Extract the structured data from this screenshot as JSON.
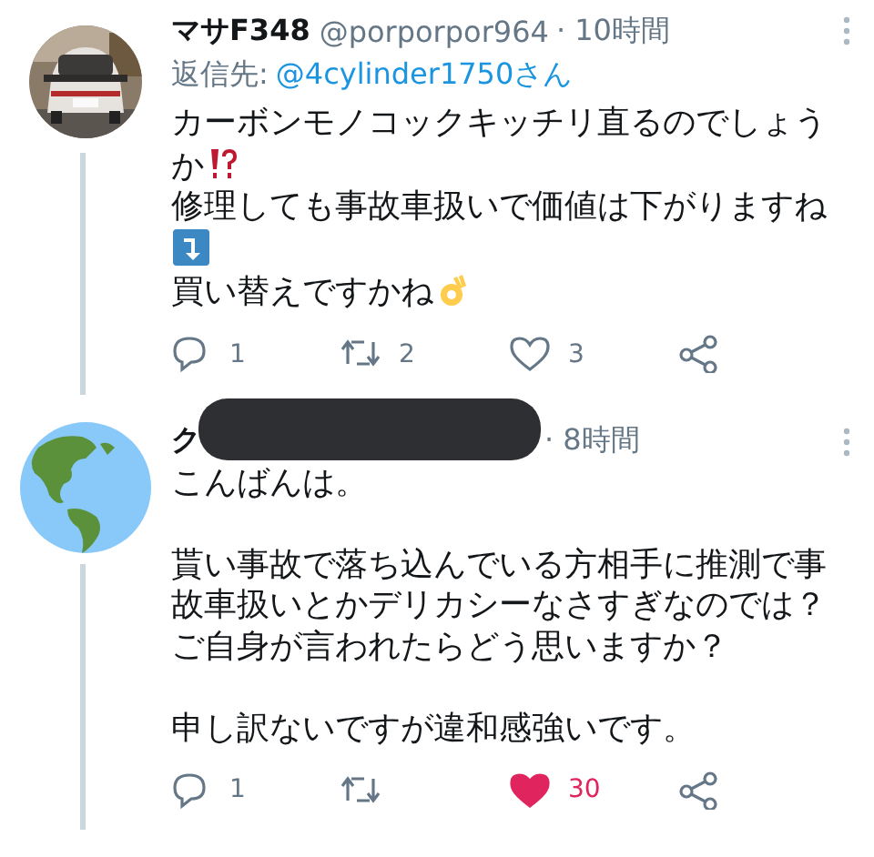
{
  "tweets": [
    {
      "avatar": {
        "kind": "picture"
      },
      "name": "マサF348",
      "handle": "@porporpor964",
      "time": "· 10時間",
      "redacted": false,
      "reply_to_label": "返信先:",
      "reply_to": "@4cylinder1750さん",
      "body": [
        {
          "kind": "text",
          "parts": [
            {
              "kind": "text",
              "text": "カーボンモノコックキッチリ直るのでしょう"
            }
          ]
        },
        {
          "kind": "text",
          "parts": [
            {
              "kind": "text",
              "text": "か"
            },
            {
              "kind": "interrobang"
            }
          ]
        },
        {
          "kind": "text",
          "parts": [
            {
              "kind": "text",
              "text": "修理しても事故車扱いで価値は下がりますね"
            }
          ]
        },
        {
          "kind": "text",
          "parts": [
            {
              "kind": "arrow"
            }
          ]
        },
        {
          "kind": "text",
          "parts": [
            {
              "kind": "text",
              "text": "買い替えですかね"
            },
            {
              "kind": "okhand"
            }
          ]
        }
      ],
      "replies": "1",
      "retweets": "2",
      "likes": "3",
      "liked": false,
      "thread_below": true
    },
    {
      "avatar": {
        "kind": "globe"
      },
      "name": "ク",
      "time": "· 8時間",
      "redacted": true,
      "body": [
        {
          "kind": "text",
          "parts": [
            {
              "kind": "text",
              "text": "こんばんは。"
            }
          ]
        },
        {
          "kind": "blank"
        },
        {
          "kind": "text",
          "parts": [
            {
              "kind": "text",
              "text": "貰い事故で落ち込んでいる方相手に推測で事故車扱いとかデリカシーなさすぎなのでは？"
            }
          ]
        },
        {
          "kind": "text",
          "parts": [
            {
              "kind": "text",
              "text": "ご自身が言われたらどう思いますか？"
            }
          ]
        },
        {
          "kind": "blank"
        },
        {
          "kind": "text",
          "parts": [
            {
              "kind": "text",
              "text": "申し訳ないですが違和感強いです。"
            }
          ]
        }
      ],
      "replies": "1",
      "likes": "30",
      "liked": true,
      "thread_below": true
    }
  ]
}
